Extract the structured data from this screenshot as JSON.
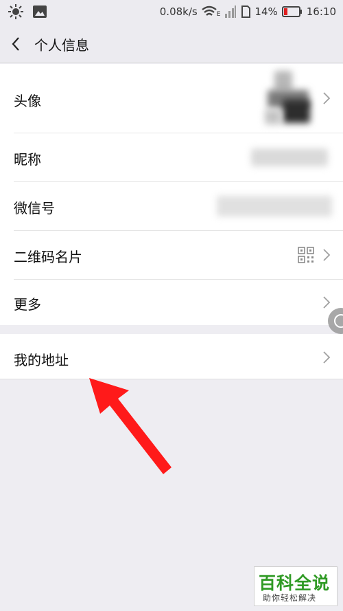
{
  "status_bar": {
    "network_speed": "0.08k/s",
    "network_type": "E",
    "battery": "14%",
    "time": "16:10",
    "icons": [
      "brightness-icon",
      "gallery-icon",
      "wifi-icon",
      "signal-icon",
      "sim-icon",
      "battery-icon"
    ]
  },
  "nav": {
    "title": "个人信息",
    "back_icon": "chevron-left-icon"
  },
  "profile_items": [
    {
      "label": "头像"
    },
    {
      "label": "昵称"
    },
    {
      "label": "微信号"
    },
    {
      "label": "二维码名片"
    },
    {
      "label": "更多"
    }
  ],
  "address_item": {
    "label": "我的地址"
  },
  "watermark": {
    "title": "百科全说",
    "subtitle": "助你轻松解决"
  },
  "colors": {
    "background": "#eeedf2",
    "row_background": "#ffffff",
    "arrow": "#ff1a1a",
    "watermark_green": "#2f9a24"
  }
}
